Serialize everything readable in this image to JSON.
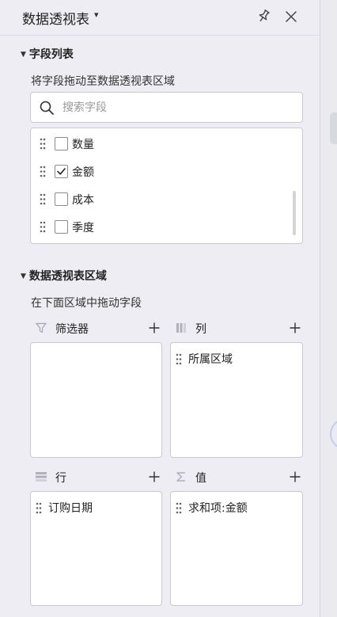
{
  "header": {
    "title": "数据透视表"
  },
  "field_section": {
    "title": "字段列表",
    "hint": "将字段拖动至数据透视表区域",
    "search_placeholder": "搜索字段",
    "fields": [
      {
        "label": "数量",
        "checked": false
      },
      {
        "label": "金额",
        "checked": true
      },
      {
        "label": "成本",
        "checked": false
      },
      {
        "label": "季度",
        "checked": false
      }
    ]
  },
  "area_section": {
    "title": "数据透视表区域",
    "hint": "在下面区域中拖动字段",
    "zones": {
      "filter": {
        "label": "筛选器",
        "items": []
      },
      "columns": {
        "label": "列",
        "items": [
          "所属区域"
        ]
      },
      "rows": {
        "label": "行",
        "items": [
          "订购日期"
        ]
      },
      "values": {
        "label": "值",
        "items": [
          "求和项:金额"
        ]
      }
    }
  },
  "icons": [
    "chevron-down-icon",
    "pin-icon",
    "close-icon",
    "search-icon",
    "drag-handle-icon",
    "checkmark-icon",
    "filter-icon",
    "columns-icon",
    "rows-icon",
    "sigma-icon",
    "plus-icon"
  ]
}
